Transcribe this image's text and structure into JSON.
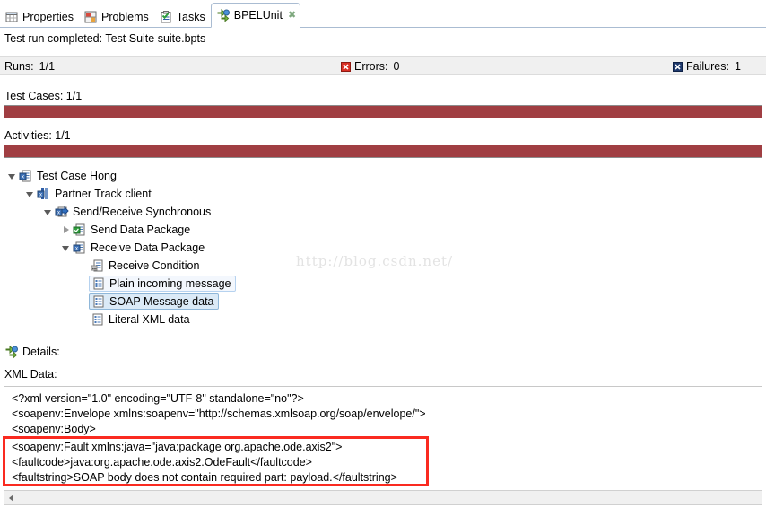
{
  "window": {
    "tabs": [
      {
        "label": "Properties",
        "icon": "properties-icon",
        "active": false
      },
      {
        "label": "Problems",
        "icon": "problems-icon",
        "active": false
      },
      {
        "label": "Tasks",
        "icon": "tasks-icon",
        "active": false
      },
      {
        "label": "BPELUnit",
        "icon": "bpelunit-icon",
        "active": true,
        "close": "✖"
      }
    ]
  },
  "status": {
    "run_message": "Test run completed: Test Suite suite.bpts"
  },
  "stats": {
    "runs_label": "Runs:",
    "runs_value": "1/1",
    "errors_label": "Errors:",
    "errors_value": "0",
    "errors_icon": "error-icon",
    "failures_label": "Failures:",
    "failures_value": "1",
    "failures_icon": "failure-icon"
  },
  "progress": {
    "bar_color": "#a03e42",
    "test_cases": {
      "label": "Test Cases: 1/1",
      "percent": 100
    },
    "activities": {
      "label": "Activities: 1/1",
      "percent": 100
    }
  },
  "tree": {
    "rows": [
      {
        "label": "Test Case Hong",
        "indent": 0,
        "twisty": "open",
        "icon": "test-case-icon",
        "state": "none"
      },
      {
        "label": "Partner Track client",
        "indent": 1,
        "twisty": "open",
        "icon": "partner-track-icon",
        "state": "none"
      },
      {
        "label": "Send/Receive Synchronous",
        "indent": 2,
        "twisty": "open",
        "icon": "send-receive-icon",
        "state": "none"
      },
      {
        "label": "Send Data Package",
        "indent": 3,
        "twisty": "closed",
        "icon": "send-package-icon",
        "state": "none"
      },
      {
        "label": "Receive Data Package",
        "indent": 3,
        "twisty": "open",
        "icon": "receive-package-icon",
        "state": "none"
      },
      {
        "label": "Receive Condition",
        "indent": 4,
        "twisty": "none",
        "icon": "receive-condition-icon",
        "state": "none"
      },
      {
        "label": "Plain incoming message",
        "indent": 4,
        "twisty": "none",
        "icon": "message-data-icon",
        "state": "light"
      },
      {
        "label": "SOAP Message data",
        "indent": 4,
        "twisty": "none",
        "icon": "message-data-icon",
        "state": "strong"
      },
      {
        "label": "Literal XML data",
        "indent": 4,
        "twisty": "none",
        "icon": "message-data-icon",
        "state": "none"
      }
    ]
  },
  "watermark": {
    "text": "http://blog.csdn.net/"
  },
  "details": {
    "label": "Details:",
    "icon": "bpelunit-icon",
    "xml_data_label": "XML Data:",
    "lines": [
      "<?xml version=\"1.0\" encoding=\"UTF-8\" standalone=\"no\"?>",
      "<soapenv:Envelope xmlns:soapenv=\"http://schemas.xmlsoap.org/soap/envelope/\">",
      "<soapenv:Body>",
      "<soapenv:Fault xmlns:java=\"java:package org.apache.ode.axis2\">",
      "<faultcode>java:org.apache.ode.axis2.OdeFault</faultcode>",
      "<faultstring>SOAP body does not contain required part: payload.</faultstring>"
    ],
    "highlight_color": "#fa2a20"
  }
}
